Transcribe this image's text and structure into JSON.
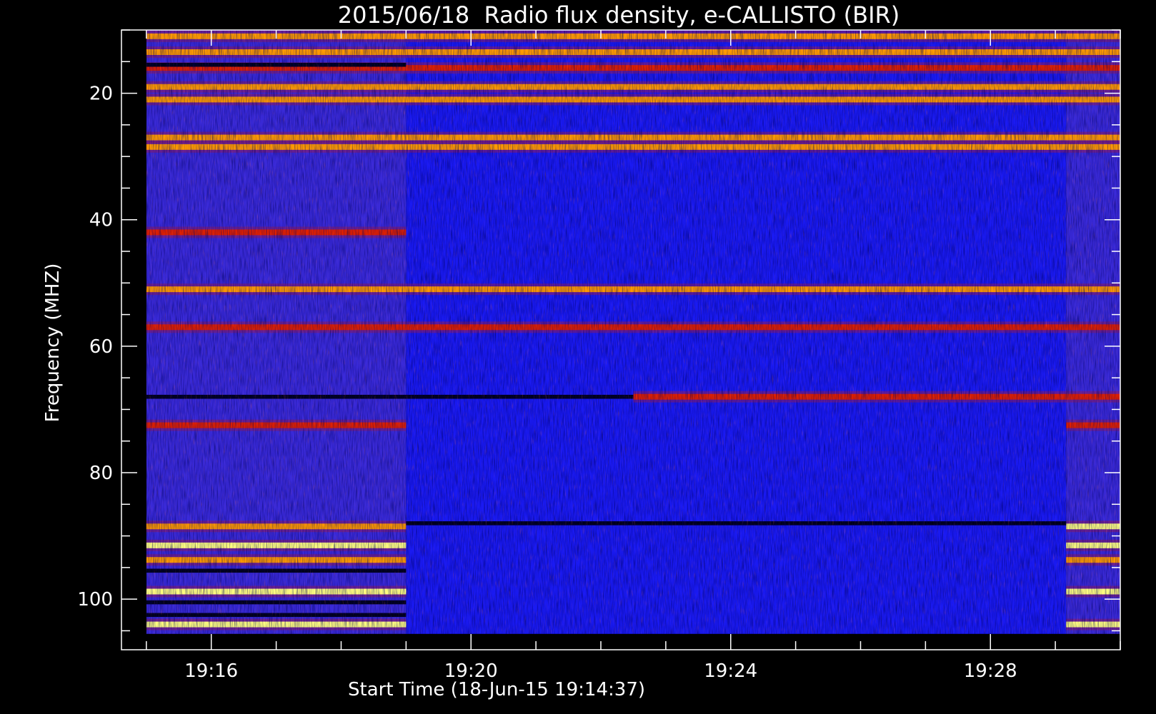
{
  "chart_data": {
    "type": "heatmap",
    "title": "2015/06/18  Radio flux density, e-CALLISTO (BIR)",
    "xlabel": "Start Time (18-Jun-15 19:14:37)",
    "ylabel": "Frequency (MHZ)",
    "x_unit": "time (UT)",
    "y_unit": "MHz",
    "x_range": [
      "19:14:37",
      "19:30:00"
    ],
    "y_range": [
      10,
      108
    ],
    "y_inverted": true,
    "data_extent": {
      "x": [
        "19:15:00",
        "19:30:00"
      ],
      "y": [
        10,
        105.5
      ]
    },
    "x_ticks": [
      "19:16",
      "19:20",
      "19:24",
      "19:28"
    ],
    "x_minor_ticks": [
      "19:15",
      "19:17",
      "19:18",
      "19:19",
      "19:21",
      "19:22",
      "19:23",
      "19:25",
      "19:26",
      "19:27",
      "19:29",
      "19:30"
    ],
    "y_ticks": [
      20,
      40,
      60,
      80,
      100
    ],
    "y_minor_ticks": [
      10,
      15,
      25,
      30,
      35,
      45,
      50,
      55,
      65,
      70,
      75,
      85,
      90,
      95,
      105
    ],
    "background_level_color": "#1e1ef0",
    "colormap": [
      "#000018",
      "#2020ff",
      "#8a1a6a",
      "#e02000",
      "#ff9a00",
      "#ffff80"
    ],
    "segments": [
      {
        "start": "19:15:00",
        "end": "19:19:00",
        "background": "#3a2ad8"
      },
      {
        "start": "19:19:00",
        "end": "19:29:10",
        "background": "#1a1af2"
      },
      {
        "start": "19:29:10",
        "end": "19:30:00",
        "background": "#3a2ad8"
      }
    ],
    "emission_bands": [
      {
        "freq": 11,
        "intensity": 0.75,
        "start": "19:15:00",
        "end": "19:30:00"
      },
      {
        "freq": 13.5,
        "intensity": 0.7,
        "start": "19:15:00",
        "end": "19:30:00"
      },
      {
        "freq": 16,
        "intensity": 0.6,
        "start": "19:15:00",
        "end": "19:30:00"
      },
      {
        "freq": 19,
        "intensity": 0.8,
        "start": "19:15:00",
        "end": "19:30:00"
      },
      {
        "freq": 21,
        "intensity": 0.85,
        "start": "19:15:00",
        "end": "19:30:00"
      },
      {
        "freq": 27,
        "intensity": 0.7,
        "start": "19:15:00",
        "end": "19:30:00"
      },
      {
        "freq": 28.5,
        "intensity": 0.75,
        "start": "19:15:00",
        "end": "19:30:00"
      },
      {
        "freq": 42,
        "intensity": 0.55,
        "start": "19:15:00",
        "end": "19:19:00"
      },
      {
        "freq": 51,
        "intensity": 0.85,
        "start": "19:15:00",
        "end": "19:30:00"
      },
      {
        "freq": 57,
        "intensity": 0.6,
        "start": "19:15:00",
        "end": "19:30:00"
      },
      {
        "freq": 68,
        "intensity": 0.55,
        "start": "19:22:30",
        "end": "19:30:00"
      },
      {
        "freq": 72.5,
        "intensity": 0.5,
        "start": "19:15:00",
        "end": "19:19:00"
      },
      {
        "freq": 72.5,
        "intensity": 0.5,
        "start": "19:29:10",
        "end": "19:30:00"
      },
      {
        "freq": 88.5,
        "intensity": 0.7,
        "start": "19:15:00",
        "end": "19:19:00"
      },
      {
        "freq": 88.5,
        "intensity": 0.95,
        "start": "19:29:10",
        "end": "19:30:00"
      },
      {
        "freq": 91.5,
        "intensity": 1.0,
        "start": "19:15:00",
        "end": "19:19:00"
      },
      {
        "freq": 91.5,
        "intensity": 0.9,
        "start": "19:29:10",
        "end": "19:30:00"
      },
      {
        "freq": 93.8,
        "intensity": 0.85,
        "start": "19:15:00",
        "end": "19:19:00"
      },
      {
        "freq": 93.8,
        "intensity": 0.85,
        "start": "19:29:10",
        "end": "19:30:00"
      },
      {
        "freq": 98.8,
        "intensity": 0.9,
        "start": "19:15:00",
        "end": "19:19:00"
      },
      {
        "freq": 98.8,
        "intensity": 0.9,
        "start": "19:29:10",
        "end": "19:30:00"
      },
      {
        "freq": 104,
        "intensity": 1.0,
        "start": "19:15:00",
        "end": "19:19:00"
      },
      {
        "freq": 104,
        "intensity": 0.95,
        "start": "19:29:10",
        "end": "19:30:00"
      }
    ],
    "absorption_bands": [
      {
        "freq": 15.5,
        "start": "19:15:00",
        "end": "19:19:00"
      },
      {
        "freq": 68,
        "start": "19:15:00",
        "end": "19:22:30"
      },
      {
        "freq": 88,
        "start": "19:19:00",
        "end": "19:29:10"
      },
      {
        "freq": 95.5,
        "start": "19:15:00",
        "end": "19:19:00"
      },
      {
        "freq": 100.5,
        "start": "19:15:00",
        "end": "19:19:00"
      },
      {
        "freq": 102.5,
        "start": "19:15:00",
        "end": "19:19:00"
      }
    ],
    "grid": false,
    "legend": "none"
  }
}
